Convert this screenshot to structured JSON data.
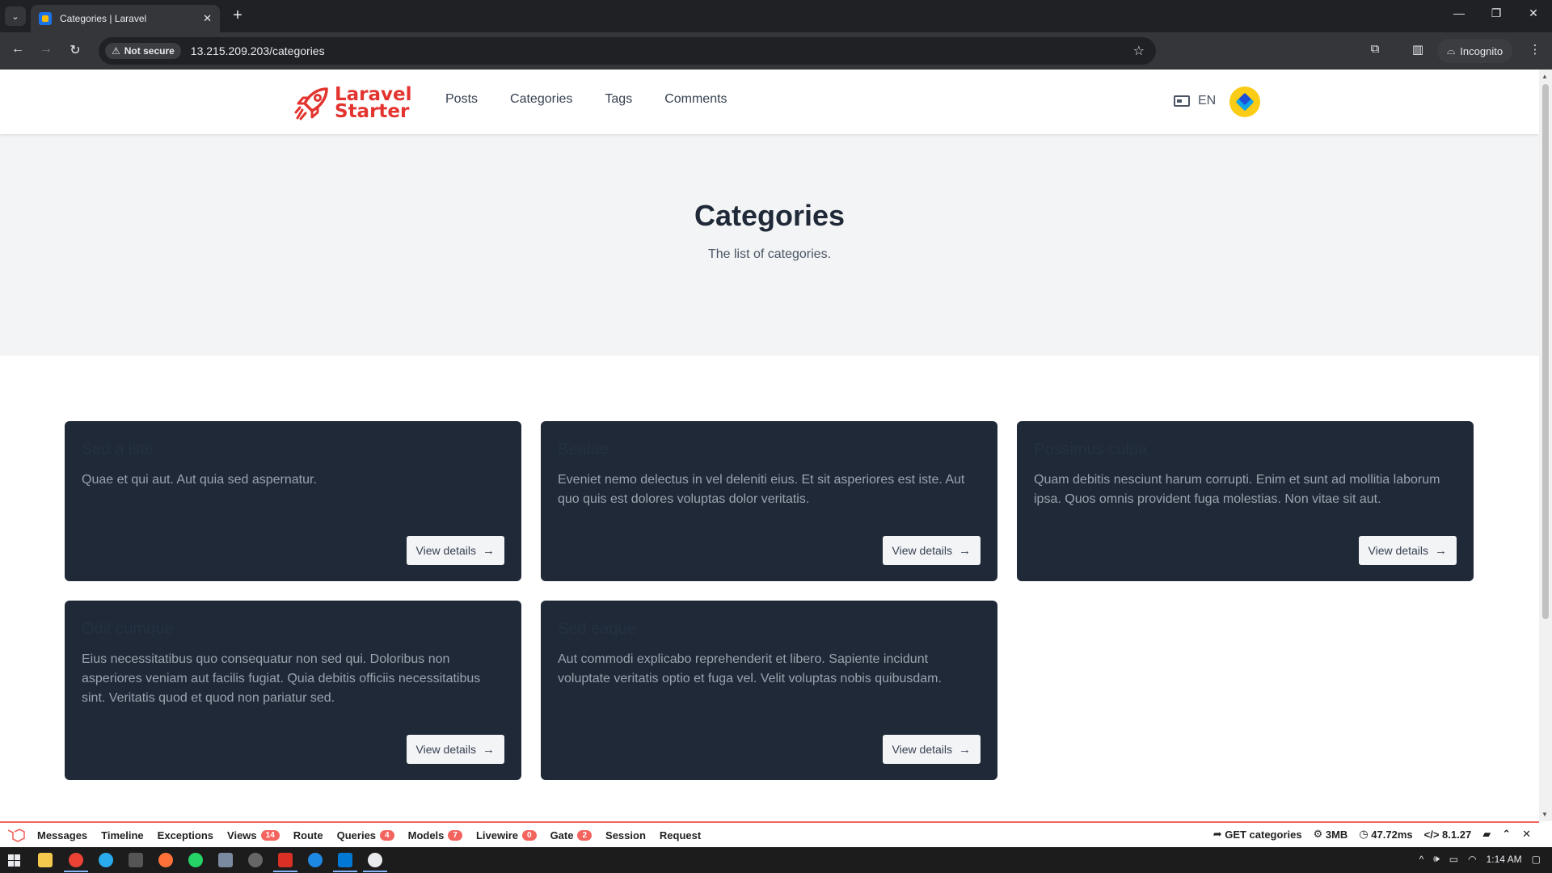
{
  "browser": {
    "tab_title": "Categories | Laravel",
    "tab_close": "✕",
    "new_tab": "+",
    "security_label": "Not secure",
    "url": "13.215.209.203/categories",
    "incognito_label": "Incognito"
  },
  "site": {
    "logo_line1": "Laravel",
    "logo_line2": "Starter",
    "nav": [
      "Posts",
      "Categories",
      "Tags",
      "Comments"
    ],
    "language": "EN"
  },
  "hero": {
    "title": "Categories",
    "subtitle": "The list of categories."
  },
  "categories": [
    {
      "title": "Sed a iste",
      "description": "Quae et qui aut. Aut quia sed aspernatur.",
      "button": "View details"
    },
    {
      "title": "Beatae",
      "description": "Eveniet nemo delectus in vel deleniti eius. Et sit asperiores est iste. Aut quo quis est dolores voluptas dolor veritatis.",
      "button": "View details"
    },
    {
      "title": "Possimus culpa",
      "description": "Quam debitis nesciunt harum corrupti. Enim et sunt ad mollitia laborum ipsa. Quos omnis provident fuga molestias. Non vitae sit aut.",
      "button": "View details"
    },
    {
      "title": "Odit cumque",
      "description": "Eius necessitatibus quo consequatur non sed qui. Doloribus non asperiores veniam aut facilis fugiat. Quia debitis officiis necessitatibus sint. Veritatis quod et quod non pariatur sed.",
      "button": "View details"
    },
    {
      "title": "Sed eaque",
      "description": "Aut commodi explicabo reprehenderit et libero. Sapiente incidunt voluptate veritatis optio et fuga vel. Velit voluptas nobis quibusdam.",
      "button": "View details"
    }
  ],
  "debugbar": {
    "tabs": [
      {
        "label": "Messages",
        "badge": ""
      },
      {
        "label": "Timeline",
        "badge": ""
      },
      {
        "label": "Exceptions",
        "badge": ""
      },
      {
        "label": "Views",
        "badge": "14"
      },
      {
        "label": "Route",
        "badge": ""
      },
      {
        "label": "Queries",
        "badge": "4"
      },
      {
        "label": "Models",
        "badge": "7"
      },
      {
        "label": "Livewire",
        "badge": "0"
      },
      {
        "label": "Gate",
        "badge": "2"
      },
      {
        "label": "Session",
        "badge": ""
      },
      {
        "label": "Request",
        "badge": ""
      }
    ],
    "route": "GET categories",
    "memory": "3MB",
    "time": "47.72ms",
    "php_version": "8.1.27"
  },
  "taskbar": {
    "clock": "1:14 AM"
  },
  "colors": {
    "brand": "#e3342f",
    "card_bg": "#1f2937",
    "hero_bg": "#f3f4f6",
    "debug_accent": "#f4645f"
  }
}
